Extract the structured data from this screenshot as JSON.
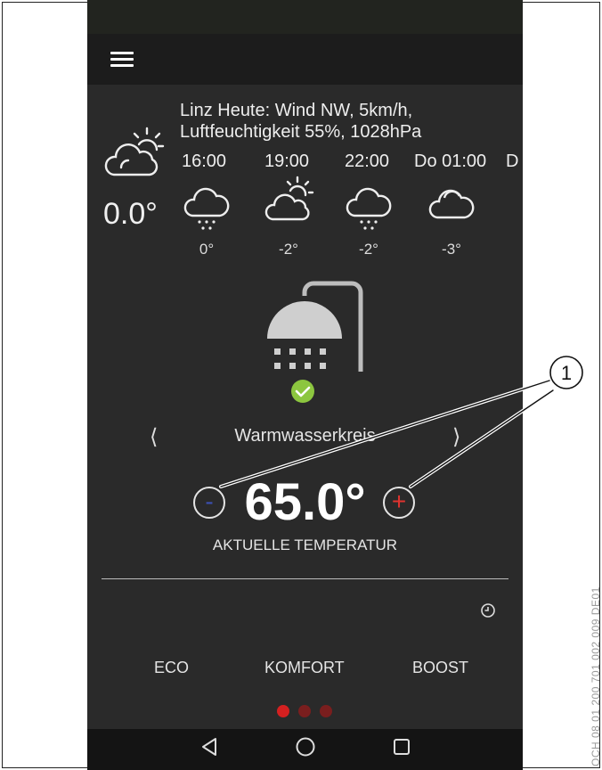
{
  "weather": {
    "location_line1": "Linz Heute: Wind NW, 5km/h,",
    "location_line2": "Luftfeuchtigkeit 55%, 1028hPa",
    "current_temp": "0.0°",
    "current_icon": "partly-cloudy-icon",
    "forecast": [
      {
        "time": "16:00",
        "icon": "snow-cloud-icon",
        "temp": "0°"
      },
      {
        "time": "19:00",
        "icon": "partly-cloudy-icon",
        "temp": "-2°"
      },
      {
        "time": "22:00",
        "icon": "snow-cloud-icon",
        "temp": "-2°"
      },
      {
        "time": "Do 01:00",
        "icon": "cloud-icon",
        "temp": "-3°"
      },
      {
        "time": "D"
      }
    ]
  },
  "circuit": {
    "name": "Warmwasserkreis",
    "prev": "⟨",
    "next": "⟩",
    "temperature": "65.0°",
    "minus": "-",
    "plus": "+",
    "temp_label": "AKTUELLE TEMPERATUR"
  },
  "modes": {
    "eco": "ECO",
    "komfort": "KOMFORT",
    "boost": "BOOST"
  },
  "callout": {
    "number": "1"
  },
  "figure_code": "OCH 08 01 200 701 002 009 DE01",
  "colors": {
    "background": "#2a2a2a",
    "appbar": "#1c1c1c",
    "minus": "#3b4fb0",
    "plus": "#e0332f",
    "check": "#8cc63f",
    "dot_active": "#d42020",
    "dot_inactive": "#7a1e1e"
  }
}
